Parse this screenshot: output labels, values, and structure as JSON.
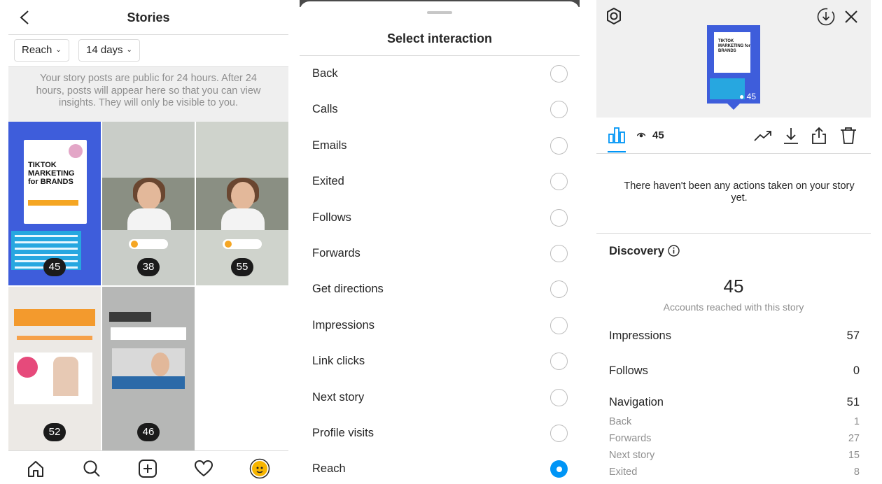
{
  "stories_panel": {
    "title": "Stories",
    "filters": {
      "metric": "Reach",
      "period": "14 days"
    },
    "notice": "Your story posts are public for 24 hours. After 24 hours, posts will appear here so that you can view insights. They will only be visible to you.",
    "tiles": [
      {
        "count": "45",
        "book_title": "TIKTOK MARKETING for BRANDS"
      },
      {
        "count": "38"
      },
      {
        "count": "55"
      },
      {
        "count": "52"
      },
      {
        "count": "46"
      }
    ],
    "nav_icons": [
      "home-icon",
      "search-icon",
      "add-post-icon",
      "heart-icon",
      "profile-avatar"
    ]
  },
  "interaction_sheet": {
    "title": "Select interaction",
    "options": [
      {
        "label": "Back",
        "selected": false
      },
      {
        "label": "Calls",
        "selected": false
      },
      {
        "label": "Emails",
        "selected": false
      },
      {
        "label": "Exited",
        "selected": false
      },
      {
        "label": "Follows",
        "selected": false
      },
      {
        "label": "Forwards",
        "selected": false
      },
      {
        "label": "Get directions",
        "selected": false
      },
      {
        "label": "Impressions",
        "selected": false
      },
      {
        "label": "Link clicks",
        "selected": false
      },
      {
        "label": "Next story",
        "selected": false
      },
      {
        "label": "Profile visits",
        "selected": false
      },
      {
        "label": "Reach",
        "selected": true
      }
    ],
    "accent": "#0095f6"
  },
  "insights_panel": {
    "thumbnail": {
      "views": "45",
      "book_title": "TIKTOK MARKETING for BRANDS"
    },
    "view_count": "45",
    "no_actions": "There haven't been any actions taken on your story yet.",
    "discovery_label": "Discovery",
    "reach_value": "45",
    "reach_label": "Accounts reached with this story",
    "metrics": [
      {
        "label": "Impressions",
        "value": "57"
      },
      {
        "label": "Follows",
        "value": "0"
      },
      {
        "label": "Navigation",
        "value": "51"
      }
    ],
    "navigation_breakdown": [
      {
        "label": "Back",
        "value": "1"
      },
      {
        "label": "Forwards",
        "value": "27"
      },
      {
        "label": "Next story",
        "value": "15"
      },
      {
        "label": "Exited",
        "value": "8"
      }
    ],
    "icons": [
      "settings-icon",
      "download-circle-icon",
      "close-icon",
      "insights-icon",
      "eye-icon",
      "promote-icon",
      "download-icon",
      "share-icon",
      "trash-icon",
      "info-icon"
    ]
  }
}
